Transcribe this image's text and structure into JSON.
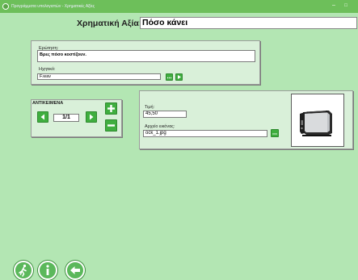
{
  "window": {
    "title": "Προγράμματα υπολογιστών - Χρηματικές Αξίες",
    "min_glyph": "–",
    "max_glyph": "□"
  },
  "header": {
    "label": "Χρηματική Αξία:",
    "value": "Πόσο κάνει"
  },
  "question_panel": {
    "question_label": "Ερώτηση:",
    "question_value": "Βρες πόσο κοστίζουν.",
    "audio_label": "Ηχητικό:",
    "audio_value": "F.wav"
  },
  "objects_panel": {
    "title": "ΑΝΤΙΚΕΙΜΕΝΑ",
    "counter": "1/1"
  },
  "item_panel": {
    "price_label": "Τιμή:",
    "price_value": "45,50",
    "image_label": "Αρχείο εικόνας:",
    "image_value": "ock_1.jpg"
  },
  "colors": {
    "background": "#b3e6b3",
    "titlebar": "#6dbf5a",
    "button_green": "#3fae3f"
  },
  "icons": [
    "app-icon",
    "arrow-left-icon",
    "arrow-right-icon",
    "plus-icon",
    "minus-icon",
    "browse-dots-icon",
    "play-icon",
    "exit-runner-icon",
    "info-icon",
    "back-arrow-icon"
  ]
}
